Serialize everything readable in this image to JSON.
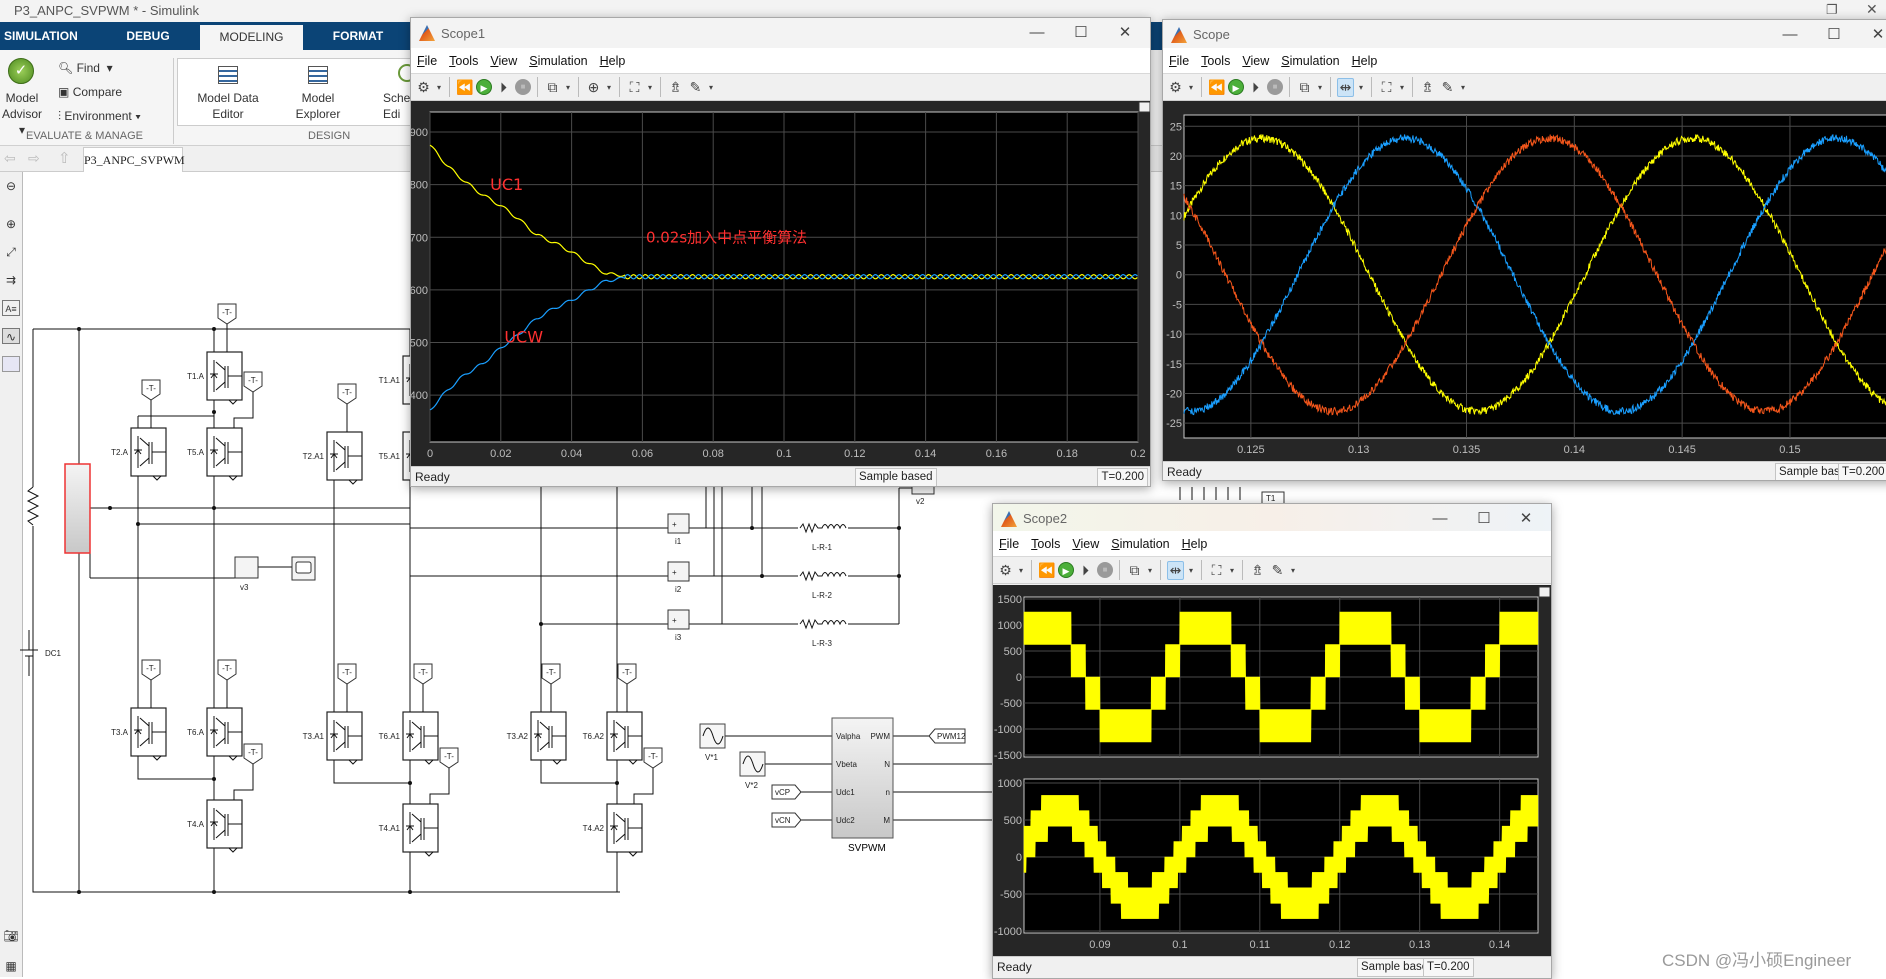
{
  "app": {
    "title": "P3_ANPC_SVPWM * - Simulink"
  },
  "ribbon": {
    "tabs": [
      {
        "label": "SIMULATION"
      },
      {
        "label": "DEBUG"
      },
      {
        "label": "MODELING",
        "active": true
      },
      {
        "label": "FORMAT"
      }
    ],
    "model_advisor": {
      "line1": "Model",
      "line2": "Advisor"
    },
    "find": "Find",
    "compare": "Compare",
    "environment": "Environment",
    "group_evaluate": "EVALUATE & MANAGE",
    "model_data_editor": {
      "line1": "Model Data",
      "line2": "Editor"
    },
    "model_explorer": {
      "line1": "Model",
      "line2": "Explorer"
    },
    "schedule_editor": {
      "line1": "Sche",
      "line2": "Edi"
    },
    "group_design": "DESIGN"
  },
  "breadcrumb": {
    "model": "P3_ANPC_SVPWM"
  },
  "diagram": {
    "igbts": [
      "T1.A",
      "T2.A",
      "T5.A",
      "T1.A1",
      "T2.A1",
      "T5.A1",
      "T3.A",
      "T6.A",
      "T4.A",
      "T3.A1",
      "T6.A1",
      "T4.A1",
      "T3.A2",
      "T6.A2",
      "T4.A2"
    ],
    "goto_tag": "-T-",
    "dc_source": "DC1",
    "voltage_meas": "v3",
    "voltage_meas2": "v2",
    "current_meas": [
      "i1",
      "i2",
      "i3"
    ],
    "loads": [
      "L-R-1",
      "L-R-2",
      "L-R-3"
    ],
    "sources": [
      "V*1",
      "V*2"
    ],
    "from_tags": [
      "vCP",
      "vCN"
    ],
    "svpwm": {
      "name": "SVPWM",
      "inputs": [
        "Valpha",
        "Vbeta",
        "Udc1",
        "Udc2"
      ],
      "outputs": [
        "PWM",
        "N",
        "n",
        "M"
      ]
    },
    "pwm_tag": "PWM12",
    "t1_tag": "T1"
  },
  "scopes": {
    "scope1": {
      "title": "Scope1",
      "menu": [
        "File",
        "Tools",
        "View",
        "Simulation",
        "Help"
      ],
      "status": "Ready",
      "mode": "Sample based",
      "time": "T=0.200"
    },
    "scope": {
      "title": "Scope",
      "menu": [
        "File",
        "Tools",
        "View",
        "Simulation",
        "Help"
      ],
      "status": "Ready",
      "mode": "Sample based",
      "time": "T=0.200"
    },
    "scope2": {
      "title": "Scope2",
      "menu": [
        "File",
        "Tools",
        "View",
        "Simulation",
        "Help"
      ],
      "status": "Ready",
      "mode": "Sample based",
      "time": "T=0.200"
    }
  },
  "toolbar_icons": [
    "gear-icon",
    "step-back-icon",
    "run-icon",
    "step-forward-icon",
    "stop-icon",
    "highlight-block-icon",
    "zoom-icon",
    "fit-to-view-icon",
    "triggers-icon",
    "measurements-icon"
  ],
  "chart_data": [
    {
      "type": "line",
      "xlim": [
        0,
        0.2
      ],
      "ylim": [
        311,
        938
      ],
      "grid": true,
      "xticks": [
        0,
        0.02,
        0.04,
        0.06,
        0.08,
        0.1,
        0.12,
        0.14,
        0.16,
        0.18,
        0.2
      ],
      "xtick_labels": [
        "0",
        "0.02",
        "0.04",
        "0.06",
        "0.08",
        "0.1",
        "0.12",
        "0.14",
        "0.16",
        "0.18",
        "0.2"
      ],
      "yticks": [
        400,
        500,
        600,
        700,
        800,
        900
      ],
      "ytick_labels": [
        "400",
        "500",
        "600",
        "700",
        "800",
        "900"
      ],
      "steady_state": 625,
      "ripple_amplitude": 4,
      "ripple_frequency_hz": 300,
      "series": [
        {
          "name": "UC1",
          "color": "#ffff00",
          "x": [
            0,
            0.005,
            0.01,
            0.015,
            0.02,
            0.025,
            0.03,
            0.035,
            0.04,
            0.045,
            0.05,
            0.055,
            0.2
          ],
          "y": [
            875,
            835,
            805,
            780,
            760,
            735,
            705,
            690,
            672,
            650,
            630,
            628,
            625
          ]
        },
        {
          "name": "UCW",
          "color": "#1a9fff",
          "x": [
            0,
            0.005,
            0.01,
            0.015,
            0.02,
            0.025,
            0.03,
            0.035,
            0.04,
            0.045,
            0.05,
            0.055,
            0.2
          ],
          "y": [
            372,
            410,
            440,
            460,
            490,
            515,
            545,
            565,
            580,
            600,
            618,
            622,
            625
          ]
        }
      ],
      "annotations": [
        {
          "text": "UC1",
          "x": 0.017,
          "y": 790,
          "color": "#ff3030"
        },
        {
          "text": "UCW",
          "x": 0.021,
          "y": 500,
          "color": "#ff3030"
        },
        {
          "text": "0.02s加入中点平衡算法",
          "x": 0.061,
          "y": 690,
          "color": "#ff3030"
        }
      ]
    },
    {
      "type": "line",
      "xlim": [
        0.1219,
        0.1545
      ],
      "ylim": [
        -27.5,
        26.9
      ],
      "grid": true,
      "xticks": [
        0.125,
        0.13,
        0.135,
        0.14,
        0.145,
        0.15
      ],
      "xtick_labels": [
        "0.125",
        "0.13",
        "0.135",
        "0.14",
        "0.145",
        "0.15"
      ],
      "yticks": [
        -25,
        -20,
        -15,
        -10,
        -5,
        0,
        5,
        10,
        15,
        20,
        25
      ],
      "ytick_labels": [
        "-25",
        "-20",
        "-15",
        "-10",
        "-5",
        "0",
        "5",
        "10",
        "15",
        "20",
        "25"
      ],
      "series": [
        {
          "color": "#ffff00",
          "amplitude": 23,
          "frequency_hz": 50,
          "peak_time": 0.1255
        },
        {
          "color": "#1a9fff",
          "amplitude": 23,
          "frequency_hz": 50,
          "peak_time": 0.13217
        },
        {
          "color": "#f4561b",
          "amplitude": 23,
          "frequency_hz": 50,
          "peak_time": 0.13883
        }
      ]
    },
    {
      "type": "area",
      "xlim": [
        0.0805,
        0.1448
      ],
      "ylim": [
        -1538,
        1538
      ],
      "grid": true,
      "xticks": [
        0.09,
        0.1,
        0.11,
        0.12,
        0.13,
        0.14
      ],
      "xtick_labels": [],
      "yticks": [
        -1500,
        -1000,
        -500,
        0,
        500,
        1000,
        1500
      ],
      "ytick_labels": [
        "-1500",
        "-1000",
        "-500",
        "0",
        "500",
        "1000",
        "1500"
      ],
      "series": [
        {
          "color": "#ffff00",
          "levels_step": 625,
          "max_level": 1250,
          "reference_amplitude": 1170,
          "frequency_hz": 50,
          "peak_time": 0.1032
        }
      ]
    },
    {
      "type": "area",
      "xlim": [
        0.0805,
        0.1448
      ],
      "ylim": [
        -1027,
        1054
      ],
      "grid": true,
      "xticks": [
        0.09,
        0.1,
        0.11,
        0.12,
        0.13,
        0.14
      ],
      "xtick_labels": [
        "0.09",
        "0.1",
        "0.11",
        "0.12",
        "0.13",
        "0.14"
      ],
      "yticks": [
        -1000,
        -500,
        0,
        500,
        1000
      ],
      "ytick_labels": [
        "-1000",
        "-500",
        "0",
        "500",
        "1000"
      ],
      "series": [
        {
          "color": "#ffff00",
          "levels_step": 208.33,
          "max_level": 833,
          "reference_amplitude": 640,
          "frequency_hz": 50,
          "peak_time": 0.105
        }
      ]
    }
  ],
  "watermark": "CSDN @冯小硕Engineer"
}
